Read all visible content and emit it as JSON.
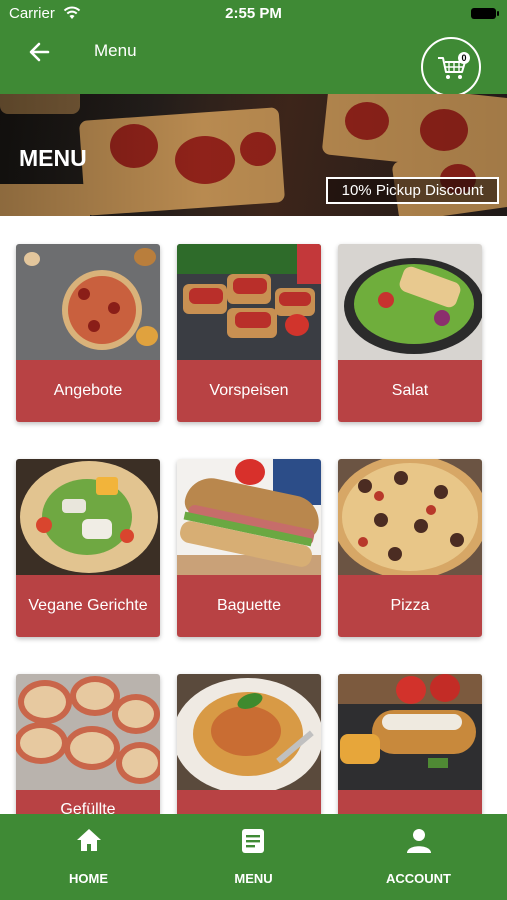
{
  "status_bar": {
    "carrier": "Carrier",
    "time": "2:55 PM"
  },
  "header": {
    "title": "Menu",
    "cart_count": "0"
  },
  "banner": {
    "title": "MENU",
    "discount_label": "10% Pickup Discount"
  },
  "categories": [
    {
      "label": "Angebote",
      "icon": "pizza-with-sides-image"
    },
    {
      "label": "Vorspeisen",
      "icon": "bruschetta-image"
    },
    {
      "label": "Salat",
      "icon": "salad-image"
    },
    {
      "label": "Vegane Gerichte",
      "icon": "vegan-wrap-image"
    },
    {
      "label": "Baguette",
      "icon": "baguette-sandwich-image"
    },
    {
      "label": "Pizza",
      "icon": "pizza-image"
    },
    {
      "label": "Gefüllte",
      "icon": "pizza-rolls-image"
    },
    {
      "label": "",
      "icon": "spaghetti-image"
    },
    {
      "label": "",
      "icon": "schnitzel-image"
    }
  ],
  "bottom_nav": [
    {
      "label": "HOME",
      "icon": "home-icon"
    },
    {
      "label": "MENU",
      "icon": "menu-list-icon"
    },
    {
      "label": "ACCOUNT",
      "icon": "account-icon"
    }
  ],
  "colors": {
    "primary_green": "#3f8a35",
    "card_red": "#b84244"
  }
}
